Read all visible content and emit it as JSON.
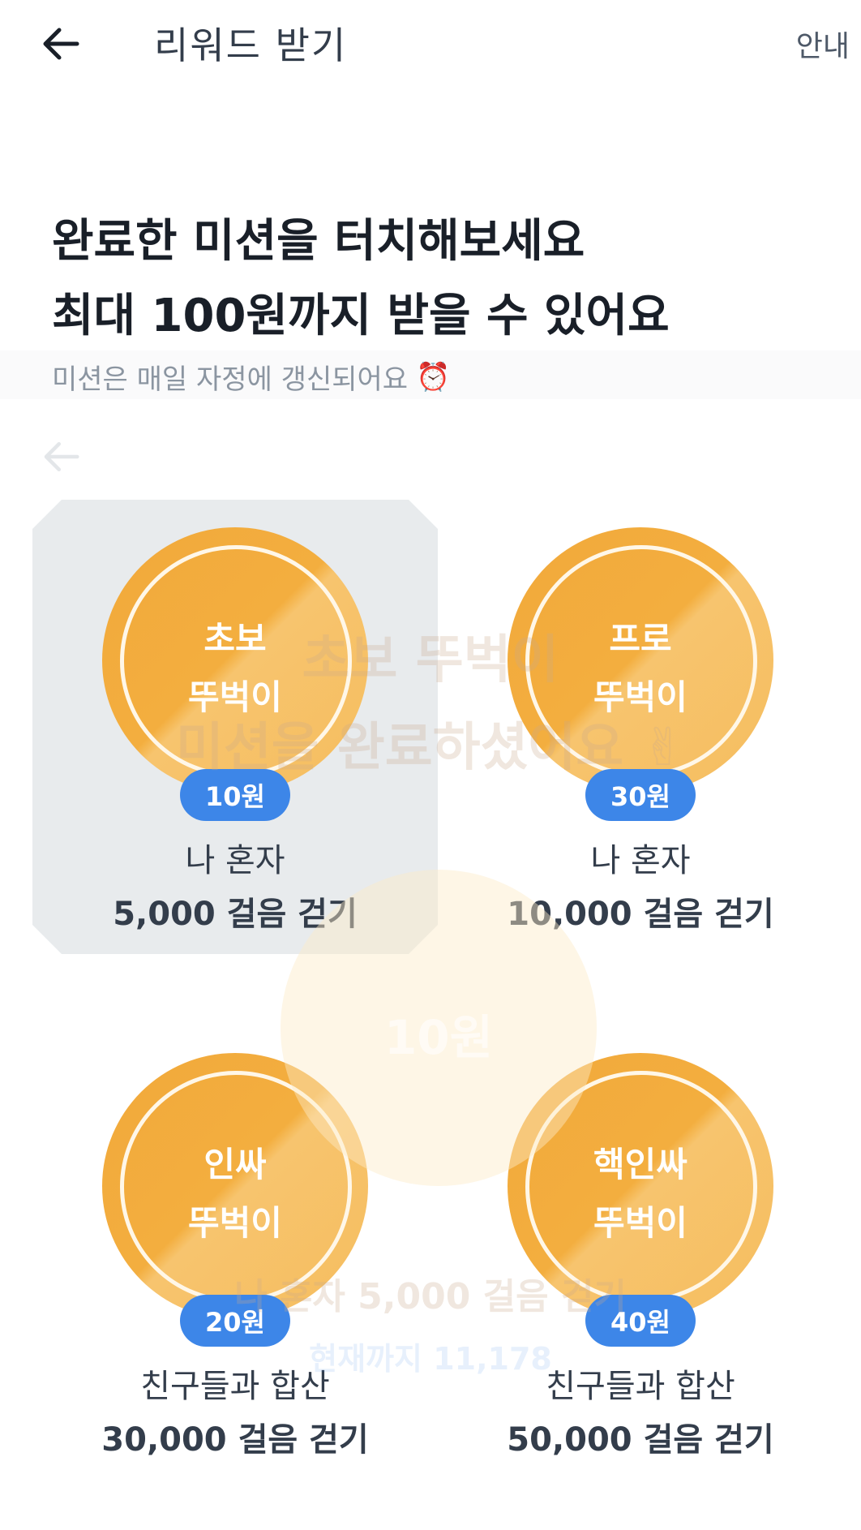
{
  "header": {
    "title": "리워드 받기",
    "info_label": "안내"
  },
  "headline": {
    "line1": "완료한 미션을 터치해보세요",
    "line2": "최대 100원까지 받을 수 있어요"
  },
  "subtitle": {
    "text": "미션은 매일 자정에 갱신되어요",
    "emoji": "⏰"
  },
  "missions": [
    {
      "name_line1": "초보",
      "name_line2": "뚜벅이",
      "reward": "10원",
      "condition_line1": "나 혼자",
      "condition_line2": "5,000 걸음 걷기",
      "selected": true
    },
    {
      "name_line1": "프로",
      "name_line2": "뚜벅이",
      "reward": "30원",
      "condition_line1": "나 혼자",
      "condition_line2": "10,000 걸음 걷기",
      "selected": false
    },
    {
      "name_line1": "인싸",
      "name_line2": "뚜벅이",
      "reward": "20원",
      "condition_line1": "친구들과 합산",
      "condition_line2": "30,000 걸음 걷기",
      "selected": false
    },
    {
      "name_line1": "핵인싸",
      "name_line2": "뚜벅이",
      "reward": "40원",
      "condition_line1": "친구들과 합산",
      "condition_line2": "50,000 걸음 걷기",
      "selected": false
    }
  ],
  "overlay": {
    "title": "초보 뚜벅이",
    "message": "미션을 완료하셨어요 ✌",
    "coin_amount": "10원",
    "condition": "나 혼자 5,000 걸음 걷기",
    "progress": "현재까지 11,178"
  },
  "colors": {
    "medal_orange": "#f2a93b",
    "reward_blue": "#3d86e8",
    "selected_bg": "#e8ebed"
  }
}
